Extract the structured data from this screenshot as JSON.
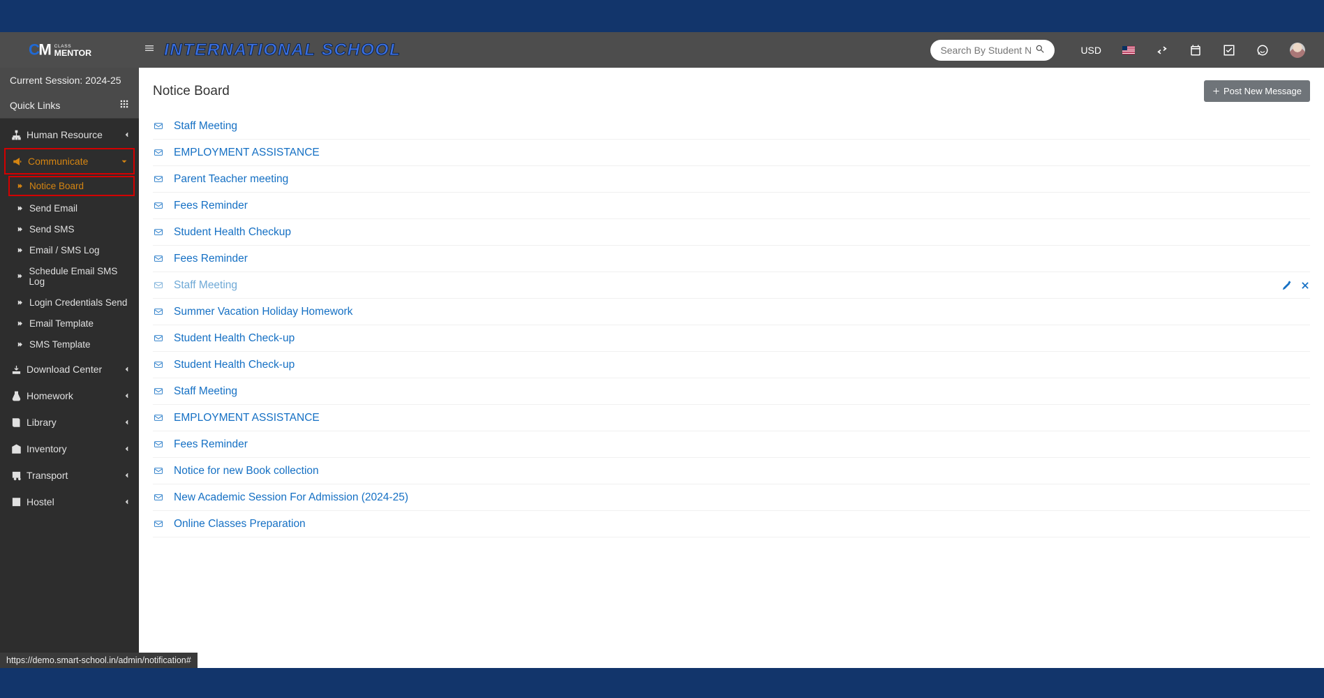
{
  "accent_color": "#d58512",
  "brand_logo_text": "CLASS MENTOR",
  "header": {
    "school_name": "INTERNATIONAL SCHOOL",
    "search_placeholder": "Search By Student Nam",
    "currency": "USD"
  },
  "sidebar": {
    "session_label": "Current Session: 2024-25",
    "quick_links": "Quick Links",
    "nav": [
      {
        "icon": "sitemap",
        "label": "Human Resource",
        "expanded": false
      },
      {
        "icon": "bullhorn",
        "label": "Communicate",
        "expanded": true,
        "active": true,
        "redbox": true,
        "children": [
          {
            "label": "Notice Board",
            "active": true,
            "redbox": true
          },
          {
            "label": "Send Email"
          },
          {
            "label": "Send SMS"
          },
          {
            "label": "Email / SMS Log"
          },
          {
            "label": "Schedule Email SMS Log"
          },
          {
            "label": "Login Credentials Send"
          },
          {
            "label": "Email Template"
          },
          {
            "label": "SMS Template"
          }
        ]
      },
      {
        "icon": "download",
        "label": "Download Center",
        "expanded": false
      },
      {
        "icon": "flask",
        "label": "Homework",
        "expanded": false
      },
      {
        "icon": "book",
        "label": "Library",
        "expanded": false
      },
      {
        "icon": "inventory",
        "label": "Inventory",
        "expanded": false
      },
      {
        "icon": "bus",
        "label": "Transport",
        "expanded": false
      },
      {
        "icon": "building",
        "label": "Hostel",
        "expanded": false
      }
    ]
  },
  "content": {
    "title": "Notice Board",
    "post_button": "Post New Message",
    "notices": [
      {
        "title": "Staff Meeting"
      },
      {
        "title": "EMPLOYMENT ASSISTANCE"
      },
      {
        "title": "Parent Teacher meeting"
      },
      {
        "title": "Fees Reminder"
      },
      {
        "title": "Student Health Checkup"
      },
      {
        "title": "Fees Reminder"
      },
      {
        "title": "Staff Meeting",
        "hovered": true
      },
      {
        "title": "Summer Vacation Holiday Homework"
      },
      {
        "title": "Student Health Check-up"
      },
      {
        "title": "Student Health Check-up"
      },
      {
        "title": "Staff Meeting"
      },
      {
        "title": "EMPLOYMENT ASSISTANCE"
      },
      {
        "title": "Fees Reminder"
      },
      {
        "title": "Notice for new Book collection"
      },
      {
        "title": "New Academic Session For Admission (2024-25)"
      },
      {
        "title": "Online Classes Preparation"
      }
    ]
  },
  "status_url": "https://demo.smart-school.in/admin/notification#"
}
